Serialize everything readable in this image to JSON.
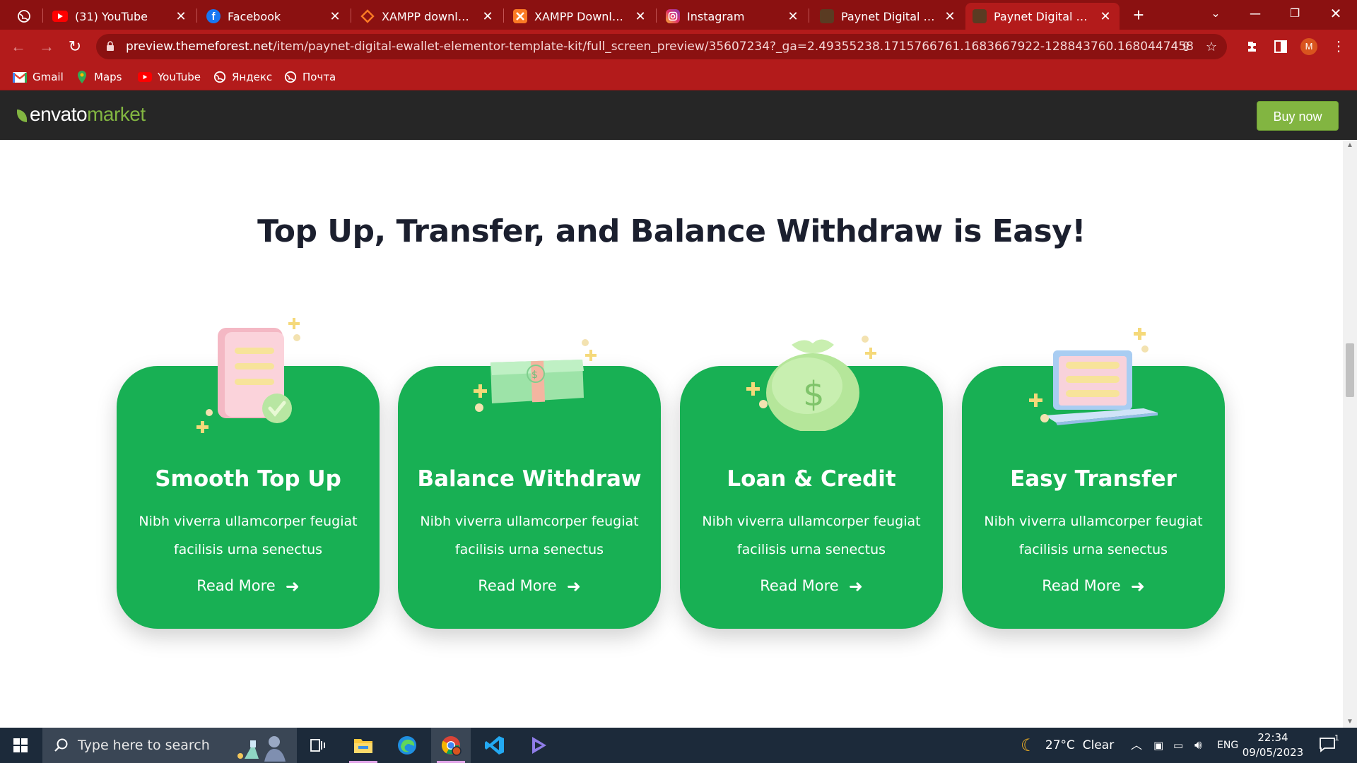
{
  "browser": {
    "tabs": [
      {
        "title": "",
        "icon": "world-icon"
      },
      {
        "title": "(31) YouTube",
        "icon": "youtube-icon"
      },
      {
        "title": "Facebook",
        "icon": "facebook-icon"
      },
      {
        "title": "XAMPP download | S",
        "icon": "xampp-icon"
      },
      {
        "title": "XAMPP Download S",
        "icon": "xampp-icon"
      },
      {
        "title": "Instagram",
        "icon": "instagram-icon"
      },
      {
        "title": "Paynet Digital E-wall",
        "icon": "paynet-icon"
      },
      {
        "title": "Paynet Digital E-wall",
        "icon": "paynet-icon"
      }
    ],
    "active_tab": 7,
    "new_tab_label": "+",
    "url_domain": "preview.themeforest.net",
    "url_path": "/item/paynet-digital-ewallet-elementor-template-kit/full_screen_preview/35607234?_ga=2.49355238.1715766761.1683667922-128843760.1680447458",
    "profile_initial": "M",
    "bookmarks": [
      {
        "label": "Gmail",
        "icon": "gmail-icon"
      },
      {
        "label": "Maps",
        "icon": "maps-icon"
      },
      {
        "label": "YouTube",
        "icon": "youtube-icon"
      },
      {
        "label": "Яндекс",
        "icon": "world-icon"
      },
      {
        "label": "Почта",
        "icon": "world-icon"
      }
    ]
  },
  "envato": {
    "logo_main": "envato",
    "logo_accent": "market",
    "buy_label": "Buy now"
  },
  "section": {
    "heading": "Top Up, Transfer, and Balance Withdraw is Easy!",
    "cards": [
      {
        "title": "Smooth Top Up",
        "desc": "Nibh viverra ullamcorper feugiat facilisis urna senectus",
        "link": "Read More",
        "illustration": "document-check-icon"
      },
      {
        "title": "Balance Withdraw",
        "desc": "Nibh viverra ullamcorper feugiat facilisis urna senectus",
        "link": "Read More",
        "illustration": "cash-stack-icon"
      },
      {
        "title": "Loan & Credit",
        "desc": "Nibh viverra ullamcorper feugiat facilisis urna senectus",
        "link": "Read More",
        "illustration": "money-bag-icon"
      },
      {
        "title": "Easy Transfer",
        "desc": "Nibh viverra ullamcorper feugiat facilisis urna senectus",
        "link": "Read More",
        "illustration": "laptop-icon"
      }
    ]
  },
  "taskbar": {
    "search_placeholder": "Type here to search",
    "weather": "27°C  Clear",
    "language": "ENG",
    "time": "22:34",
    "date": "09/05/2023",
    "notification_count": "1"
  },
  "colors": {
    "browser_frame": "#b31b1b",
    "card_green": "#18b054",
    "envato_green": "#82b541",
    "heading": "#1b1f2e"
  }
}
